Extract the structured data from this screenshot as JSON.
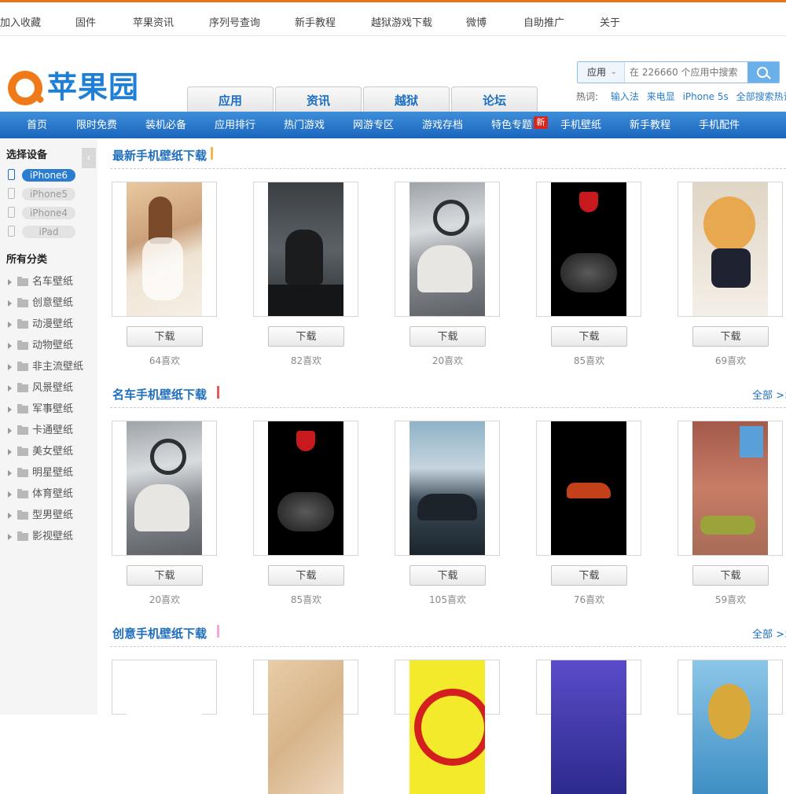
{
  "topbar": [
    "加入收藏",
    "固件",
    "苹果资讯",
    "序列号查询",
    "新手教程",
    "越狱游戏下载",
    "微博",
    "自助推广",
    "关于"
  ],
  "logo": "苹果园",
  "main_tabs": [
    "应用",
    "资讯",
    "越狱",
    "论坛"
  ],
  "search": {
    "category": "应用",
    "placeholder": "在 226660 个应用中搜索"
  },
  "hotwords": {
    "label": "热词:",
    "words": [
      "输入法",
      "来电显",
      "iPhone 5s",
      "全部搜索热词"
    ]
  },
  "nav": [
    "首页",
    "限时免费",
    "装机必备",
    "应用排行",
    "热门游戏",
    "网游专区",
    "游戏存档",
    "特色专题",
    "手机壁纸",
    "新手教程",
    "手机配件"
  ],
  "nav_badge": "新",
  "sidebar": {
    "device_title": "选择设备",
    "devices": [
      "iPhone6",
      "iPhone5",
      "iPhone4",
      "iPad"
    ],
    "category_title": "所有分类",
    "categories": [
      "名车壁纸",
      "创意壁纸",
      "动漫壁纸",
      "动物壁纸",
      "非主流壁纸",
      "风景壁纸",
      "军事壁纸",
      "卡通壁纸",
      "美女壁纸",
      "明星壁纸",
      "体育壁纸",
      "型男壁纸",
      "影视壁纸"
    ]
  },
  "sections": [
    {
      "title": "最新手机壁纸下载",
      "bar_color": "#f4b84a",
      "more": "",
      "items": [
        {
          "thumb": "girl",
          "button": "下载",
          "likes": "64喜欢"
        },
        {
          "thumb": "wolverine",
          "button": "下载",
          "likes": "82喜欢"
        },
        {
          "thumb": "car-interior",
          "button": "下载",
          "likes": "20喜欢"
        },
        {
          "thumb": "motorcycle",
          "button": "下载",
          "likes": "85喜欢"
        },
        {
          "thumb": "dog",
          "button": "下载",
          "likes": "69喜欢"
        }
      ]
    },
    {
      "title": "名车手机壁纸下载",
      "bar_color": "#e85a5a",
      "more": "全部 >>",
      "items": [
        {
          "thumb": "car-interior",
          "button": "下载",
          "likes": "20喜欢"
        },
        {
          "thumb": "motorcycle",
          "button": "下载",
          "likes": "85喜欢"
        },
        {
          "thumb": "supercar",
          "button": "下载",
          "likes": "105喜欢"
        },
        {
          "thumb": "night-car",
          "button": "下载",
          "likes": "76喜欢"
        },
        {
          "thumb": "ruins-car",
          "button": "下载",
          "likes": "59喜欢"
        }
      ]
    },
    {
      "title": "创意手机壁纸下载",
      "bar_color": "#f2a8d8",
      "more": "全部 >>",
      "items": [
        {
          "thumb": "white"
        },
        {
          "thumb": "map"
        },
        {
          "thumb": "yellow-sign"
        },
        {
          "thumb": "purple"
        },
        {
          "thumb": "pineapple"
        }
      ]
    }
  ]
}
